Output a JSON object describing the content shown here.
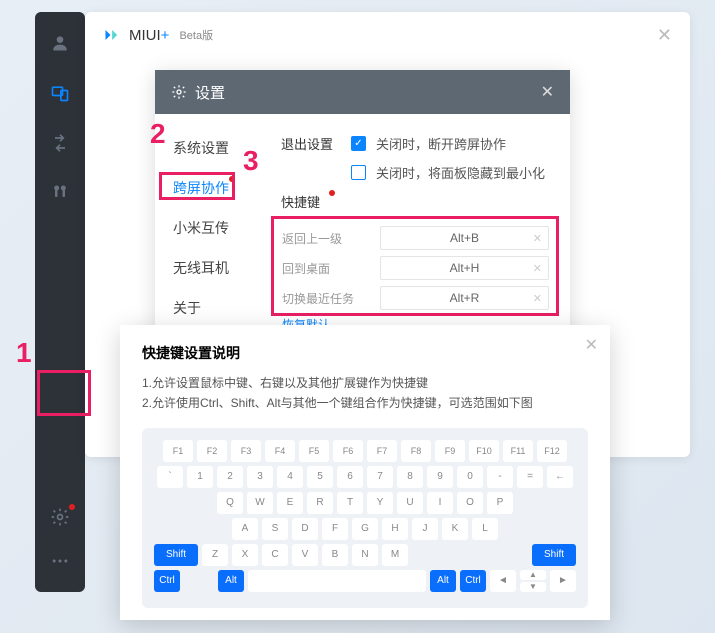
{
  "brand": {
    "name": "MIUI",
    "plus": "+",
    "suffix": "Beta版"
  },
  "settings": {
    "title": "设置",
    "nav": {
      "system": "系统设置",
      "cross": "跨屏协作",
      "miconnect": "小米互传",
      "wireless": "无线耳机",
      "about": "关于"
    },
    "exit_section_label": "退出设置",
    "exit_options": {
      "disconnect": "关闭时，断开跨屏协作",
      "minimize": "关闭时，将面板隐藏到最小化"
    },
    "shortcut_label": "快捷键",
    "shortcuts": [
      {
        "name": "返回上一级",
        "value": "Alt+B"
      },
      {
        "name": "回到桌面",
        "value": "Alt+H"
      },
      {
        "name": "切换最近任务",
        "value": "Alt+R"
      }
    ],
    "restore": "恢复默认"
  },
  "help": {
    "title": "快捷键设置说明",
    "lines": [
      "1.允许设置鼠标中键、右键以及其他扩展键作为快捷键",
      "2.允许使用Ctrl、Shift、Alt与其他一个键组合作为快捷键，可选范围如下图"
    ]
  },
  "keyboard": {
    "row_fn": [
      "F1",
      "F2",
      "F3",
      "F4",
      "F5",
      "F6",
      "F7",
      "F8",
      "F9",
      "F10",
      "F11",
      "F12"
    ],
    "row_num": [
      "`",
      "1",
      "2",
      "3",
      "4",
      "5",
      "6",
      "7",
      "8",
      "9",
      "0",
      "-",
      "=",
      "←"
    ],
    "row_q": [
      "Q",
      "W",
      "E",
      "R",
      "T",
      "Y",
      "U",
      "I",
      "O",
      "P"
    ],
    "row_a": [
      "A",
      "S",
      "D",
      "F",
      "G",
      "H",
      "J",
      "K",
      "L"
    ],
    "row_z": [
      "Z",
      "X",
      "C",
      "V",
      "B",
      "N",
      "M"
    ],
    "shift": "Shift",
    "ctrl": "Ctrl",
    "alt": "Alt",
    "arrows": [
      "◄",
      "▲",
      "▼",
      "►"
    ]
  },
  "annotations": {
    "a1": "1",
    "a2": "2",
    "a3": "3"
  }
}
